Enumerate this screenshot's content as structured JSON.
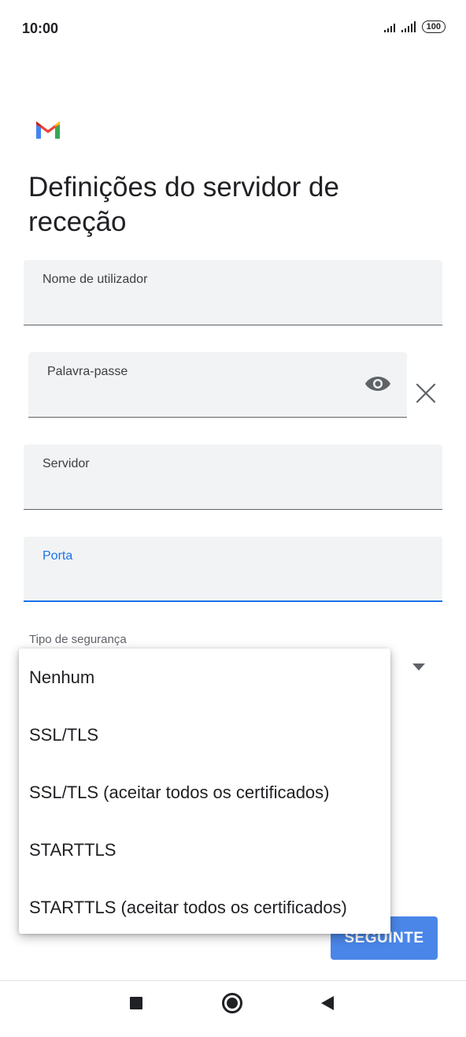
{
  "status_bar": {
    "time": "10:00",
    "battery": "100",
    "signal_icons": [
      "signal-icon",
      "signal-icon"
    ]
  },
  "app": {
    "logo": "gmail-logo",
    "title": "Definições do servidor de receção"
  },
  "form": {
    "username_label": "Nome de utilizador",
    "username_value": "",
    "password_label": "Palavra-passe",
    "password_value": "",
    "server_label": "Servidor",
    "server_value": "",
    "port_label": "Porta",
    "port_value": "",
    "security_label": "Tipo de segurança",
    "focused_field": "port"
  },
  "security_dropdown": {
    "expanded": true,
    "options": [
      "Nenhum",
      "SSL/TLS",
      "SSL/TLS (aceitar todos os certificados)",
      "STARTTLS",
      "STARTTLS (aceitar todos os certificados)"
    ]
  },
  "actions": {
    "next_label": "SEGUINTE"
  },
  "colors": {
    "accent": "#1a73e8",
    "button": "#4a86e8",
    "field_bg": "#f1f3f4"
  },
  "nav_bar": {
    "icons": [
      "recents-icon",
      "home-icon",
      "back-icon"
    ]
  }
}
